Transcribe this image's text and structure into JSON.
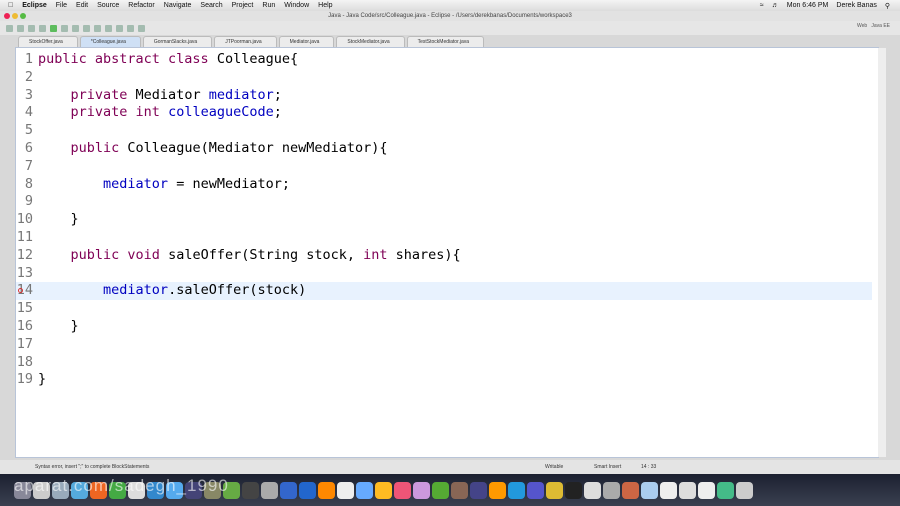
{
  "menubar": {
    "app": "Eclipse",
    "items": [
      "File",
      "Edit",
      "Source",
      "Refactor",
      "Navigate",
      "Search",
      "Project",
      "Run",
      "Window",
      "Help"
    ],
    "clock": "Mon 6:46 PM",
    "user": "Derek Banas"
  },
  "window": {
    "title": "Java - Java Code/src/Colleague.java - Eclipse - /Users/derekbanas/Documents/workspace3"
  },
  "perspectives": {
    "web": "Web",
    "javaee": "Java EE"
  },
  "tabs": [
    "StockOffer.java",
    "*Colleague.java",
    "GormanSlacks.java",
    "JTPoorman.java",
    "Mediator.java",
    "StockMediator.java",
    "TestStockMediator.java"
  ],
  "code": [
    {
      "n": "1",
      "t": [
        [
          "kw",
          "public abstract class "
        ],
        [
          "",
          "Colleague{"
        ]
      ]
    },
    {
      "n": "2",
      "t": []
    },
    {
      "n": "3",
      "t": [
        [
          "",
          "    "
        ],
        [
          "kw",
          "private "
        ],
        [
          "",
          "Mediator "
        ],
        [
          "fd",
          "mediator"
        ],
        [
          "",
          ";"
        ]
      ]
    },
    {
      "n": "4",
      "t": [
        [
          "",
          "    "
        ],
        [
          "kw",
          "private int "
        ],
        [
          "fd",
          "colleagueCode"
        ],
        [
          "",
          ";"
        ]
      ]
    },
    {
      "n": "5",
      "t": []
    },
    {
      "n": "6",
      "t": [
        [
          "",
          "    "
        ],
        [
          "kw",
          "public "
        ],
        [
          "",
          "Colleague(Mediator newMediator){"
        ]
      ]
    },
    {
      "n": "7",
      "t": []
    },
    {
      "n": "8",
      "t": [
        [
          "",
          "        "
        ],
        [
          "fd",
          "mediator"
        ],
        [
          "",
          " = newMediator;"
        ]
      ]
    },
    {
      "n": "9",
      "t": []
    },
    {
      "n": "10",
      "t": [
        [
          "",
          "    }"
        ]
      ]
    },
    {
      "n": "11",
      "t": []
    },
    {
      "n": "12",
      "t": [
        [
          "",
          "    "
        ],
        [
          "kw",
          "public void "
        ],
        [
          "",
          "saleOffer(String stock, "
        ],
        [
          "kw",
          "int "
        ],
        [
          "",
          "shares){"
        ]
      ]
    },
    {
      "n": "13",
      "t": []
    },
    {
      "n": "14",
      "t": [
        [
          "",
          "        "
        ],
        [
          "fd",
          "mediator"
        ],
        [
          "",
          ".saleOffer(stock)"
        ]
      ]
    },
    {
      "n": "15",
      "t": []
    },
    {
      "n": "16",
      "t": [
        [
          "",
          "    }"
        ]
      ]
    },
    {
      "n": "17",
      "t": []
    },
    {
      "n": "18",
      "t": []
    },
    {
      "n": "19",
      "t": [
        [
          "",
          "}"
        ]
      ]
    }
  ],
  "status": {
    "message": "Syntax error, insert \";\" to complete BlockStatements",
    "writable": "Writable",
    "insert": "Smart Insert",
    "position": "14 : 33"
  },
  "watermark": "aparat.com/sadegh_1990",
  "colors": {
    "keyword": "#7f0055",
    "field": "#0000c0",
    "current_line": "#e8f2fe"
  }
}
